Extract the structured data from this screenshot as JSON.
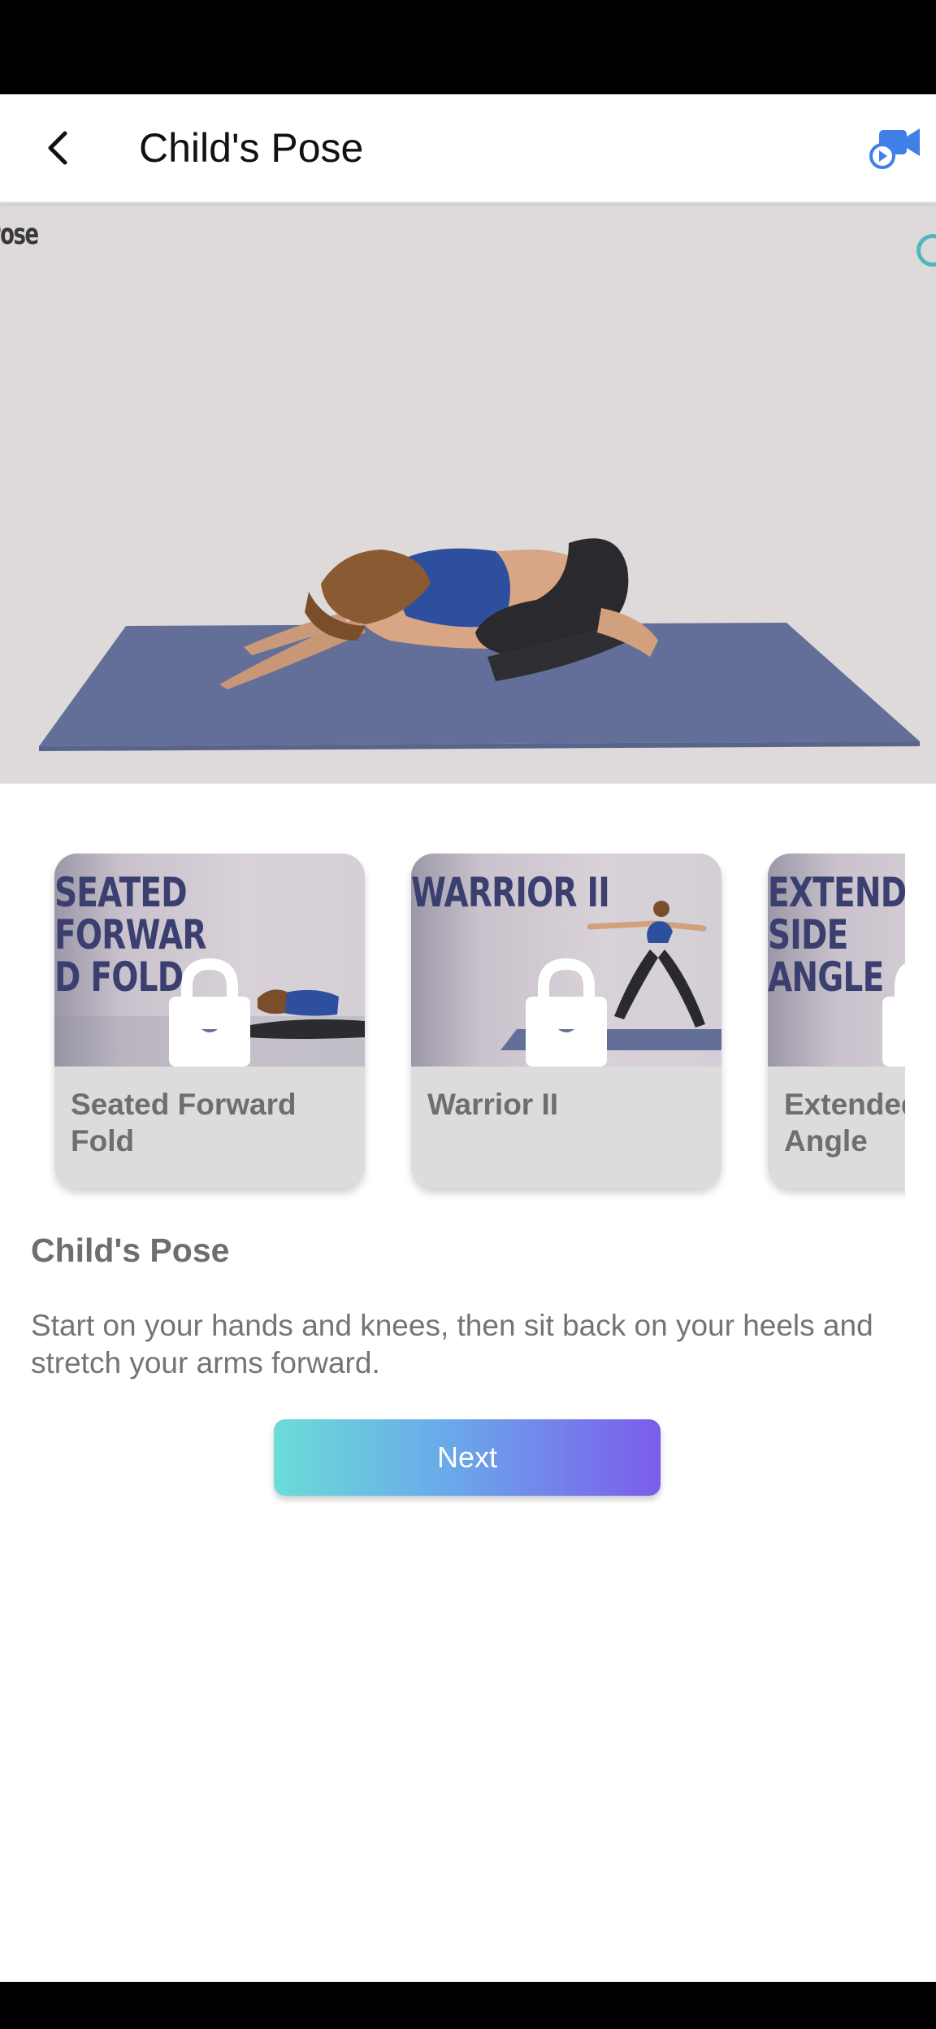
{
  "header": {
    "title": "Child's Pose",
    "back_icon": "chevron-left-icon",
    "video_icon": "video-camera-icon",
    "accent_color": "#3f7fe6"
  },
  "hero": {
    "overlay_label": "ld's Pose",
    "mat_color": "#636f98"
  },
  "carousel": {
    "cards": [
      {
        "image_text": "SEATED\nFORWAR\nD FOLD",
        "label": "Seated Forward Fold",
        "locked": true
      },
      {
        "image_text": "WARRIOR II",
        "label": "Warrior II",
        "locked": true
      },
      {
        "image_text": "EXTEND\nSIDE\nANGLE",
        "label": "Extended Side Angle",
        "locked": true
      }
    ]
  },
  "pose": {
    "title": "Child's Pose",
    "description": "Start on your hands and knees, then sit back on your heels and stretch your arms forward."
  },
  "actions": {
    "next_label": "Next",
    "gradient": [
      "#6bdcd8",
      "#6aa9ea",
      "#7c5cec"
    ]
  }
}
